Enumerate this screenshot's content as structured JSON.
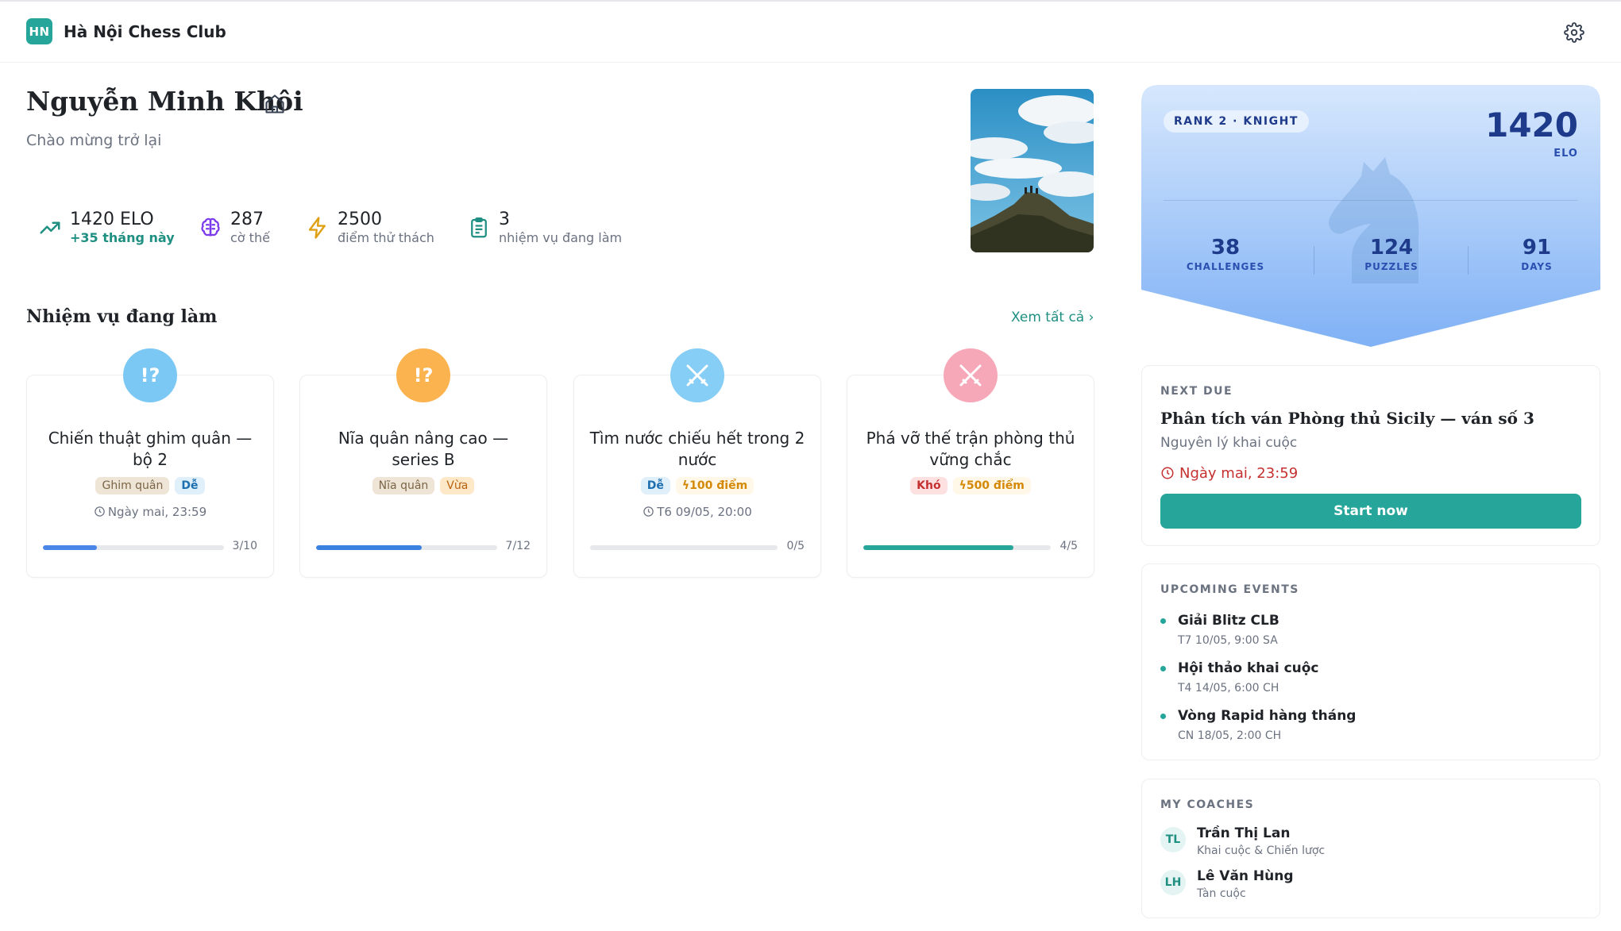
{
  "header": {
    "logo_text": "HN",
    "club_name": "Hà Nội Chess Club"
  },
  "profile": {
    "name": "Nguyễn Minh Khôi",
    "welcome": "Chào mừng trở lại"
  },
  "stats": [
    {
      "value": "1420 ELO",
      "sub": "+35 tháng này",
      "icon": "trending-up-icon"
    },
    {
      "value": "287",
      "sub": "cờ thế",
      "icon": "brain-icon"
    },
    {
      "value": "2500",
      "sub": "điểm thử thách",
      "icon": "lightning-icon"
    },
    {
      "value": "3",
      "sub": "nhiệm vụ đang làm",
      "icon": "clipboard-icon"
    }
  ],
  "missions": {
    "title": "Nhiệm vụ đang làm",
    "see_all": "Xem tất cả ›",
    "items": [
      {
        "title": "Chiến thuật ghim quân — bộ 2",
        "badge": "!?",
        "tags": [
          "Ghim quân",
          "Dễ"
        ],
        "due": "Ngày mai, 23:59",
        "progress_label": "3/10",
        "progress": 0.3,
        "color": "#4a86e8"
      },
      {
        "title": "Nĩa quân nâng cao — series B",
        "badge": "!?",
        "tags": [
          "Nĩa quân",
          "Vừa"
        ],
        "due": "",
        "progress_label": "7/12",
        "progress": 0.583,
        "color": "#3b82e0"
      },
      {
        "title": "Tìm nước chiếu hết trong 2 nước",
        "badge": "swords-icon",
        "tags": [
          "Dễ",
          "100 điểm"
        ],
        "due": "T6 09/05, 20:00",
        "progress_label": "0/5",
        "progress": 0,
        "color": "#4a86e8"
      },
      {
        "title": "Phá vỡ thế trận phòng thủ vững chắc",
        "badge": "swords-icon",
        "tags": [
          "Khó",
          "500 điểm"
        ],
        "due": "",
        "progress_label": "4/5",
        "progress": 0.8,
        "color": "#26a69a"
      }
    ]
  },
  "rank_card": {
    "rank_label": "RANK 2 · KNIGHT",
    "elo": "1420",
    "elo_label": "ELO",
    "stats": [
      {
        "value": "38",
        "label": "CHALLENGES"
      },
      {
        "value": "124",
        "label": "PUZZLES"
      },
      {
        "value": "91",
        "label": "DAYS"
      }
    ]
  },
  "next_due": {
    "heading": "NEXT DUE",
    "title": "Phân tích ván Phòng thủ Sicily — ván số 3",
    "subtitle": "Nguyên lý khai cuộc",
    "due": "Ngày mai, 23:59",
    "button": "Start now"
  },
  "events": {
    "heading": "UPCOMING EVENTS",
    "items": [
      {
        "title": "Giải Blitz CLB",
        "date": "T7 10/05, 9:00 SA"
      },
      {
        "title": "Hội thảo khai cuộc",
        "date": "T4 14/05, 6:00 CH"
      },
      {
        "title": "Vòng Rapid hàng tháng",
        "date": "CN 18/05, 2:00 CH"
      }
    ]
  },
  "coaches": {
    "heading": "MY COACHES",
    "items": [
      {
        "initials": "TL",
        "name": "Trần Thị Lan",
        "role": "Khai cuộc & Chiến lược"
      },
      {
        "initials": "LH",
        "name": "Lê Văn Hùng",
        "role": "Tàn cuộc"
      }
    ]
  },
  "colors": {
    "accent": "#26a69a",
    "rank_blue": "#1e3a8a",
    "danger": "#c53030"
  }
}
